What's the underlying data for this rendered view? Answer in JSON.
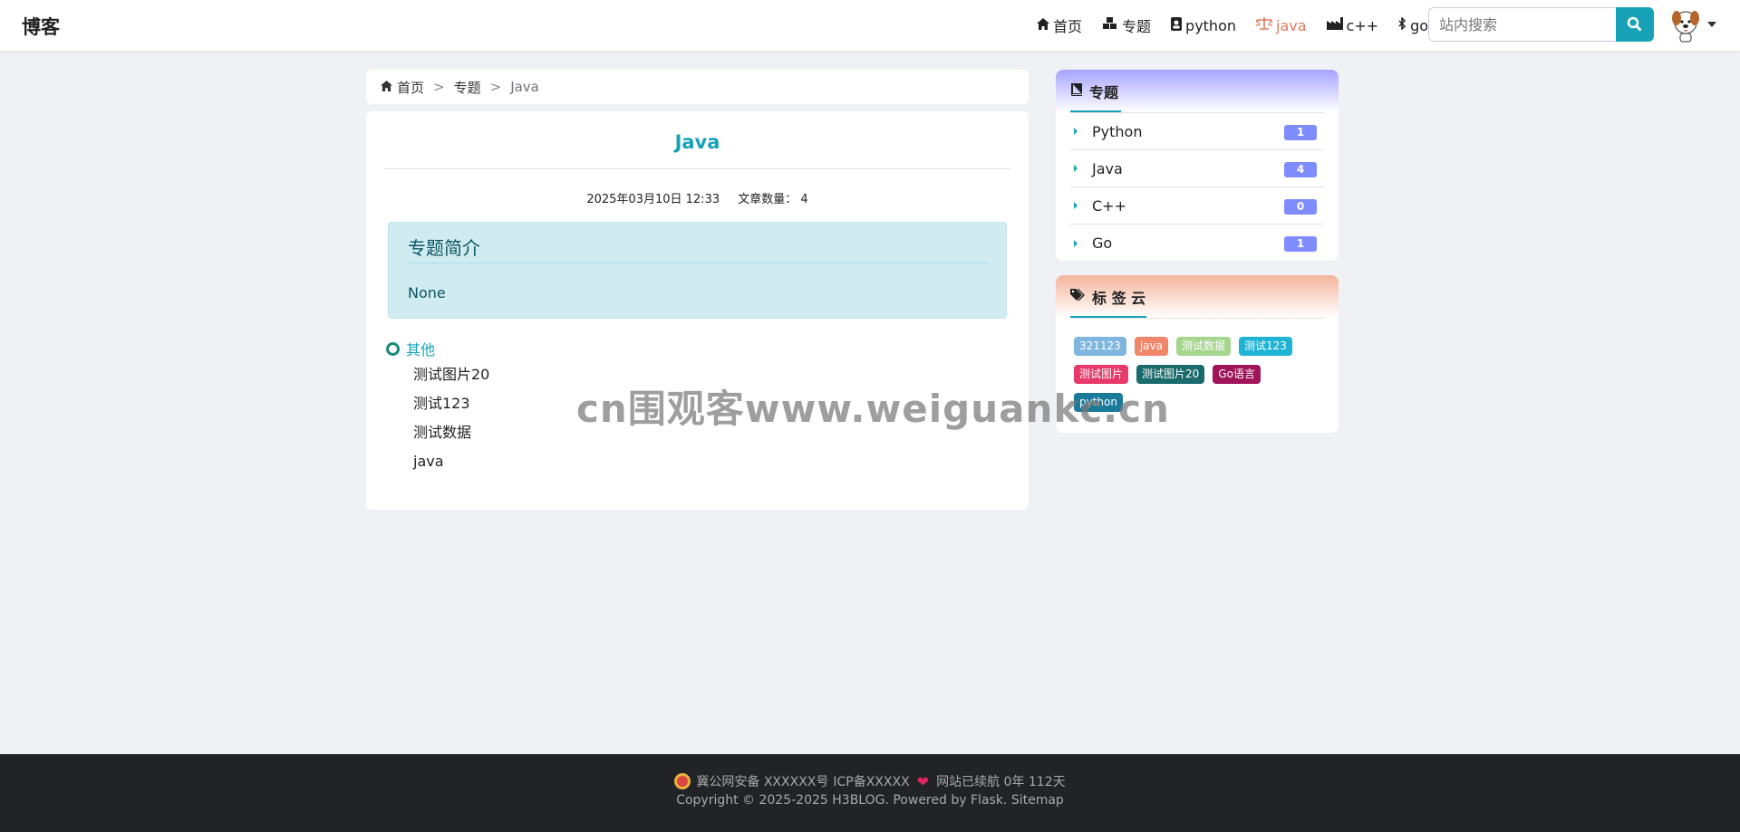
{
  "navbar": {
    "brand": "博客",
    "links": [
      {
        "label": "首页",
        "icon": "home-icon",
        "active": false
      },
      {
        "label": "专题",
        "icon": "cubes-icon",
        "active": false
      },
      {
        "label": "python",
        "icon": "address-card-icon",
        "active": false
      },
      {
        "label": "java",
        "icon": "balance-scale-icon",
        "active": true
      },
      {
        "label": "c++",
        "icon": "industry-icon",
        "active": false
      },
      {
        "label": "go",
        "icon": "bluetooth-icon",
        "active": false
      }
    ],
    "search_placeholder": "站内搜索",
    "active_color": "#e07a5f"
  },
  "breadcrumb": {
    "home": "首页",
    "topics": "专题",
    "current": "Java",
    "separator": ">"
  },
  "topic": {
    "title": "Java",
    "date": "2025年03月10日 12:33",
    "article_count": "文章数量： 4",
    "intro_heading": "专题简介",
    "intro_text": "None",
    "group_label": "其他",
    "articles": [
      "测试图片20",
      "测试123",
      "测试数据",
      "java"
    ]
  },
  "sidebar": {
    "topics_title": "专题",
    "topics": [
      {
        "name": "Python",
        "count": "1"
      },
      {
        "name": "Java",
        "count": "4"
      },
      {
        "name": "C++",
        "count": "0"
      },
      {
        "name": "Go",
        "count": "1"
      }
    ],
    "tags_title": "标 签 云",
    "tags": [
      {
        "label": "321123",
        "color": "#7fb6e0"
      },
      {
        "label": "java",
        "color": "#f0866a"
      },
      {
        "label": "测试数据",
        "color": "#a6d58e"
      },
      {
        "label": "测试123",
        "color": "#1fb3d6"
      },
      {
        "label": "测试图片",
        "color": "#e8396b"
      },
      {
        "label": "测试图片20",
        "color": "#1a6b6b"
      },
      {
        "label": "Go语言",
        "color": "#a0145a"
      },
      {
        "label": "python",
        "color": "#1a7a9a"
      }
    ]
  },
  "watermark": "cn围观客www.weiguankc.cn",
  "footer": {
    "beian": "冀公网安备 XXXXXX号",
    "icp": "ICP备XXXXX",
    "runtime": "网站已续航 0年 112天",
    "copyright": "Copyright © 2025-2025 H3BLOG. Powered by",
    "flask": "Flask",
    "sitemap": "Sitemap"
  }
}
